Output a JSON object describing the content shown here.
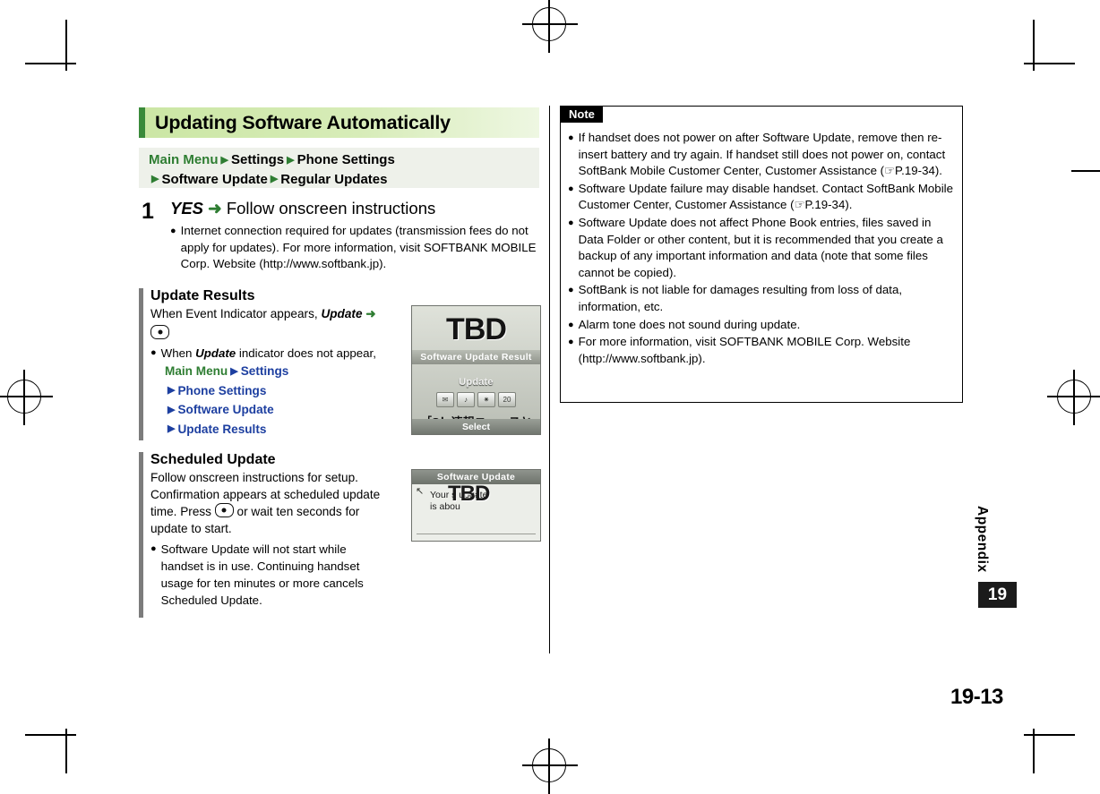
{
  "section": {
    "title": "Updating Software Automatically",
    "breadcrumb": {
      "line1": [
        "Main Menu",
        "Settings",
        "Phone Settings"
      ],
      "line2": [
        "Software Update",
        "Regular Updates"
      ]
    }
  },
  "step": {
    "number": "1",
    "title_italic": "YES",
    "title_arrow": "➜",
    "title_rest": "Follow onscreen instructions",
    "bullets": [
      "Internet connection required for updates (transmission fees do not apply for updates). For more information, visit SOFTBANK MOBILE Corp. Website (http://www.softbank.jp)."
    ]
  },
  "update_results": {
    "heading": "Update Results",
    "intro_prefix": "When Event Indicator appears,",
    "intro_italic": "Update",
    "intro_arrow": "➜",
    "bullet_prefix": "When",
    "bullet_italic": "Update",
    "bullet_rest": "indicator does not appear,",
    "path": [
      "Main Menu",
      "Settings",
      "Phone Settings",
      "Software Update",
      "Update Results"
    ]
  },
  "scheduled_update": {
    "heading": "Scheduled Update",
    "body_line1": "Follow onscreen instructions for setup.",
    "body_line2": "Confirmation appears at scheduled update",
    "body_line3_pre": "time. Press",
    "body_line3_post": "or wait ten seconds for",
    "body_line4": "update to start.",
    "bullets": [
      "Software Update will not start while handset is in use. Continuing handset usage for ten minutes or more cancels Scheduled Update."
    ]
  },
  "screenshots": {
    "result": {
      "tbd": "TBD",
      "titlebar": "Software Update Result",
      "mid_label": "Update",
      "icons": [
        "✉",
        "♪",
        "✶",
        "📅"
      ],
      "jp_line": "［S！速報ニュースとは？］",
      "select": "Select"
    },
    "scheduled": {
      "titlebar": "Software  Update",
      "corner": "↖",
      "line1": "Your  s        update",
      "line2": "is  abou",
      "tbd": "TBD"
    }
  },
  "note": {
    "label": "Note",
    "items": [
      "If handset does not power on after Software Update, remove then re-insert battery and try again. If handset still does not power on, contact SoftBank Mobile Customer Center, Customer Assistance (☞P.19-34).",
      "Software Update failure may disable handset. Contact SoftBank Mobile Customer Center, Customer Assistance (☞P.19-34).",
      "Software Update does not affect Phone Book entries, files saved in Data Folder or other content, but it is recommended that you create a backup of any important information and data (note that some files cannot be copied).",
      "SoftBank is not liable for damages resulting from loss of data, information, etc.",
      "Alarm tone does not sound during update.",
      "For more information, visit SOFTBANK MOBILE Corp. Website (http://www.softbank.jp)."
    ]
  },
  "page_edge": {
    "appendix": "Appendix",
    "chapter": "19",
    "folio": "19-13"
  }
}
